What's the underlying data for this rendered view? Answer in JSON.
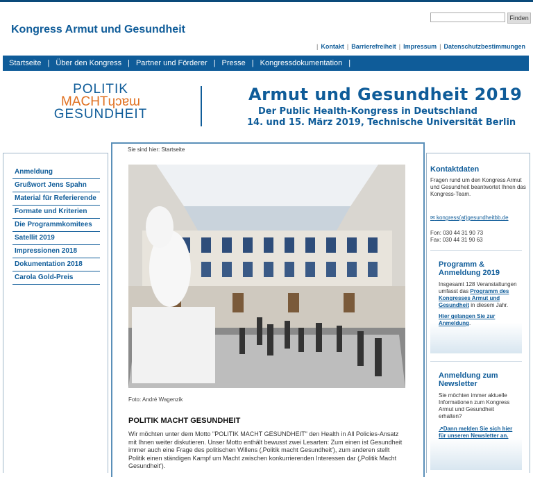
{
  "header": {
    "site_title": "Kongress Armut und Gesundheit",
    "search_button": "Finden",
    "search_placeholder": "",
    "meta_links": [
      "Kontakt",
      "Barrierefreiheit",
      "Impressum",
      "Datenschutzbestimmungen"
    ]
  },
  "main_nav": [
    "Startseite",
    "Über den Kongress",
    "Partner und Förderer",
    "Presse",
    "Kongressdokumentation"
  ],
  "banner": {
    "logo_line1": "POLITIK",
    "logo_line2": "MACHTɥɔɐɯ",
    "logo_line3": "GESUNDHEIT",
    "title": "Armut und Gesundheit 2019",
    "subtitle1": "Der Public Health-Kongress in Deutschland",
    "subtitle2": "14. und 15. März 2019, Technische Universität Berlin"
  },
  "left_nav": [
    "Anmeldung",
    "Grußwort Jens Spahn",
    "Material für Referierende",
    "Formate und Kriterien",
    "Die Programmkomitees",
    "Satellit 2019",
    "Impressionen 2018",
    "Dokumentation 2018",
    "Carola Gold-Preis"
  ],
  "content": {
    "breadcrumb": "Sie sind hier: Startseite",
    "caption": "Foto: André Wagenzik",
    "heading": "POLITIK MACHT GESUNDHEIT",
    "body": "Wir möchten unter dem Motto \"POLITIK MACHT GESUNDHEIT\" den Health in All Policies-Ansatz mit Ihnen weiter diskutieren. Unser Motto enthält bewusst zwei Lesarten: Zum einen ist Gesundheit immer auch eine Frage des politischen Willens (‚Politik macht Gesundheit'), zum anderen stellt Politik einen ständigen Kampf um Macht zwischen konkurrierenden Interessen dar (‚Politik Macht Gesundheit')."
  },
  "sidebar": {
    "contact_title": "Kontaktdaten",
    "contact_text": "Fragen rund um den Kongress Armut und Gesundheit beantwortet Ihnen das Kongress-Team.",
    "contact_email": "kongress(at)gesundheitbb.de",
    "phone": "Fon: 030 44 31 90 73",
    "fax": "Fax: 030 44 31 90 63",
    "box1_title": "Programm & Anmeldung 2019",
    "box1_text_a": "Insgesamt 128 Veranstaltungen umfasst das ",
    "box1_link": "Programm des Kongresses Armut und Gesundheit",
    "box1_text_b": " in diesem Jahr.",
    "box1_link2": "Hier gelangen Sie zur Anmeldung",
    "box2_title": "Anmeldung zum Newsletter",
    "box2_text": "Sie möchten immer aktuelle Informationen zum Kongress Armut und Gesundheit erhalten?",
    "box2_link": "Dann melden Sie sich hier für unseren Newsletter an."
  },
  "colors": {
    "brand_blue": "#0f5c99",
    "accent_orange": "#e07020"
  }
}
